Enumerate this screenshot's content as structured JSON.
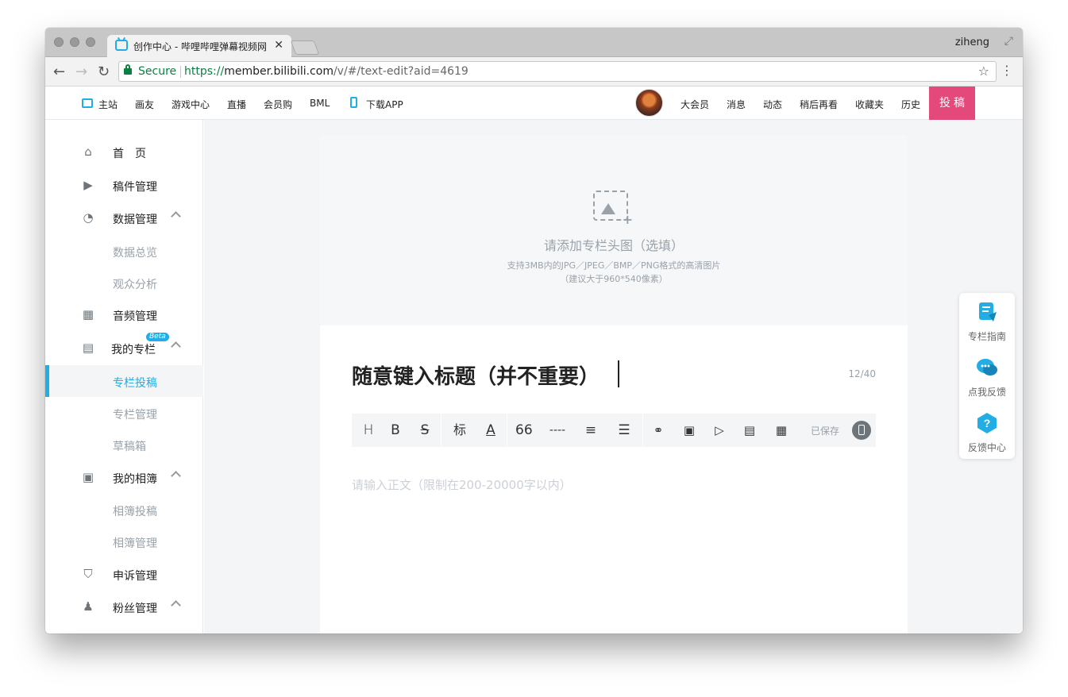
{
  "browser": {
    "tab_title": "创作中心 - 哔哩哔哩弹幕视频网",
    "tab_close": "✕",
    "profile": "ziheng",
    "back": "←",
    "forward": "→",
    "reload": "↻",
    "secure_label": "Secure",
    "url_scheme": "https://",
    "url_host": "member.bilibili.com",
    "url_path": "/v/#/text-edit?aid=4619",
    "star": "☆",
    "menu": "⋮",
    "fullscreen": "⤢"
  },
  "header": {
    "nav": [
      "主站",
      "画友",
      "游戏中心",
      "直播",
      "会员购",
      "BML",
      "下载APP"
    ],
    "right": [
      "大会员",
      "消息",
      "动态",
      "稍后再看",
      "收藏夹",
      "历史"
    ],
    "post_button": "投稿"
  },
  "sidebar": {
    "items": [
      {
        "label": "首　页",
        "icon": "home-icon",
        "glyph": "⌂"
      },
      {
        "label": "稿件管理",
        "icon": "video-icon",
        "glyph": "▶"
      },
      {
        "label": "数据管理",
        "icon": "data-icon",
        "glyph": "◔"
      },
      {
        "label": "数据总览"
      },
      {
        "label": "观众分析"
      },
      {
        "label": "音频管理",
        "icon": "audio-icon",
        "glyph": "▦"
      },
      {
        "label": "我的专栏",
        "icon": "article-icon",
        "glyph": "▤",
        "badge": "Beta"
      },
      {
        "label": "专栏投稿"
      },
      {
        "label": "专栏管理"
      },
      {
        "label": "草稿箱"
      },
      {
        "label": "我的相簿",
        "icon": "album-icon",
        "glyph": "▣"
      },
      {
        "label": "相簿投稿"
      },
      {
        "label": "相簿管理"
      },
      {
        "label": "申诉管理",
        "icon": "shield-icon",
        "glyph": "⛉"
      },
      {
        "label": "粉丝管理",
        "icon": "fans-icon",
        "glyph": "♟"
      }
    ]
  },
  "editor": {
    "cover_title": "请添加专栏头图（选填）",
    "cover_hint_1": "支持3MB内的JPG／JPEG／BMP／PNG格式的高清图片",
    "cover_hint_2": "（建议大于960*540像素）",
    "title": "随意键入标题（并不重要）",
    "title_count": "12/40",
    "toolbar": {
      "heading": "H",
      "bold": "B",
      "strike": "S",
      "label": "标",
      "color": "A",
      "quote": "66",
      "divider": "----",
      "align": "≡",
      "list": "☰",
      "link": "⚭",
      "image": "▣",
      "video": "▷",
      "card": "▤",
      "more": "▦"
    },
    "saved": "已保存",
    "body_placeholder": "请输入正文（限制在200-20000字以内）"
  },
  "float": {
    "items": [
      {
        "label": "专栏指南",
        "icon": "guide-icon"
      },
      {
        "label": "点我反馈",
        "icon": "feedback-icon"
      },
      {
        "label": "反馈中心",
        "icon": "help-center-icon"
      }
    ]
  },
  "colors": {
    "accent": "#23ade5",
    "post_button": "#e3497a",
    "secure_green": "#0b8043"
  }
}
